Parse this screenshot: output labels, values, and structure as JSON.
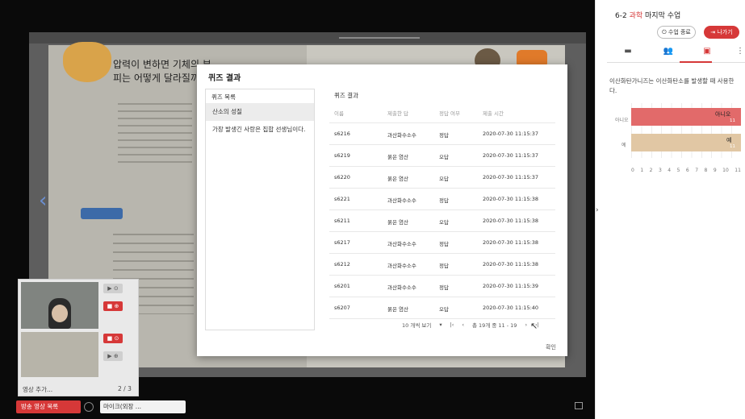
{
  "slide": {
    "title": "압력이 변하면 기체의 부피는 어떻게 달라질까요?"
  },
  "video_panel": {
    "label": "영상 추가...",
    "count": "2 / 3",
    "btn1": "▶ ⊙",
    "btn2": "■ ⊕",
    "btn3": "■ ⊙",
    "btn4": "▶ ⊕"
  },
  "bottombar": {
    "broadcast_label": "방송 영상 목록",
    "mic_label": "마이크(외장 ..."
  },
  "side": {
    "title_prefix": "6-2",
    "title_accent": "과학",
    "title_suffix": "마지막 수업",
    "end_button": "⏻ 수업 종료",
    "exit_button": "⇥ 나가기",
    "tab_chat": "▬",
    "tab_people": "👥",
    "tab_quiz": "▣",
    "kebab": "⋮",
    "question": "이산화탄가니즈는 이산화탄소를 발생할 때 사용한다.",
    "expand_arrow": "›"
  },
  "chart_data": {
    "type": "bar",
    "orientation": "horizontal",
    "categories": [
      "아니오",
      "예"
    ],
    "values": [
      11,
      11
    ],
    "xlim": [
      0,
      11
    ],
    "xticks": [
      "0",
      "1",
      "2",
      "3",
      "4",
      "5",
      "6",
      "7",
      "8",
      "9",
      "10",
      "11"
    ],
    "category_labels": [
      "아니오",
      "예"
    ],
    "bar_sublabels": [
      "11",
      "11"
    ],
    "colors": [
      "#e26a6a",
      "#e1c7a4"
    ]
  },
  "modal": {
    "title": "퀴즈 결과",
    "list_header": "퀴즈 목록",
    "list_items": [
      "산소의 성질",
      "가장 발생긴 사랑은 집합 선생님이다."
    ],
    "results_title": "퀴즈 결과",
    "columns": [
      "이름",
      "제출한 답",
      "정답 여부",
      "제출 시간"
    ],
    "rows": [
      [
        "s6216",
        "과산화수소수",
        "정답",
        "2020-07-30 11:15:37"
      ],
      [
        "s6219",
        "묽은 염산",
        "오답",
        "2020-07-30 11:15:37"
      ],
      [
        "s6220",
        "묽은 염산",
        "오답",
        "2020-07-30 11:15:37"
      ],
      [
        "s6221",
        "과산화수소수",
        "정답",
        "2020-07-30 11:15:38"
      ],
      [
        "s6211",
        "묽은 염산",
        "오답",
        "2020-07-30 11:15:38"
      ],
      [
        "s6217",
        "과산화수소수",
        "정답",
        "2020-07-30 11:15:38"
      ],
      [
        "s6212",
        "과산화수소수",
        "정답",
        "2020-07-30 11:15:38"
      ],
      [
        "s6201",
        "과산화수소수",
        "정답",
        "2020-07-30 11:15:39"
      ],
      [
        "s6207",
        "묽은 염산",
        "오답",
        "2020-07-30 11:15:40"
      ]
    ],
    "page_size_label": "10 개씩 보기",
    "page_info": "총 19개 중 11 - 19",
    "confirm": "확인"
  }
}
